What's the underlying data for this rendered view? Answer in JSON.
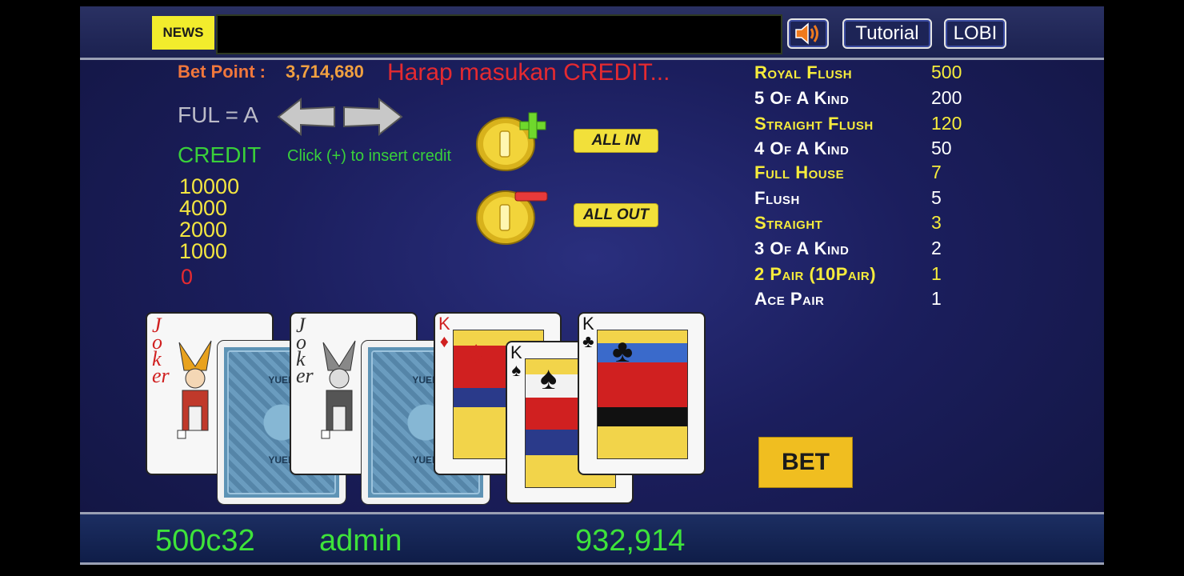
{
  "header": {
    "news_label": "NEWS",
    "news_text": "",
    "sound_icon": "speaker-icon",
    "tutorial_label": "Tutorial",
    "lobby_label": "LOBI"
  },
  "bet": {
    "bet_point_label": "Bet Point :",
    "bet_point_value": "3,714,680",
    "status_message": "Harap masukan CREDIT...",
    "ful_label": "FUL = A"
  },
  "credit": {
    "label": "CREDIT",
    "hint": "Click (+) to insert credit",
    "options": [
      "10000",
      "4000",
      "2000",
      "1000",
      "0"
    ],
    "all_in_label": "ALL IN",
    "all_out_label": "ALL OUT"
  },
  "paytable": [
    {
      "hand": "Royal Flush",
      "payout": "500"
    },
    {
      "hand": "5 Of A Kind",
      "payout": "200"
    },
    {
      "hand": "Straight Flush",
      "payout": "120"
    },
    {
      "hand": "4 Of A Kind",
      "payout": "50"
    },
    {
      "hand": "Full House",
      "payout": "7"
    },
    {
      "hand": "Flush",
      "payout": "5"
    },
    {
      "hand": "Straight",
      "payout": "3"
    },
    {
      "hand": "3 Of A Kind",
      "payout": "2"
    },
    {
      "hand": "2 Pair (10Pair)",
      "payout": "1"
    },
    {
      "hand": "Ace Pair",
      "payout": "1"
    }
  ],
  "cards": {
    "joker_text": "Joker",
    "back_text": "YUEN",
    "king_rank": "K",
    "suit_diamond": "♦",
    "suit_spade": "♠",
    "suit_club": "♣"
  },
  "bet_button_label": "BET",
  "footer": {
    "table_id": "500c32",
    "username": "admin",
    "balance": "932,914"
  },
  "colors": {
    "accent_yellow": "#f6ec3c",
    "credit_green": "#39d03a",
    "alert_red": "#e52a30",
    "bet_orange": "#f0773c"
  }
}
